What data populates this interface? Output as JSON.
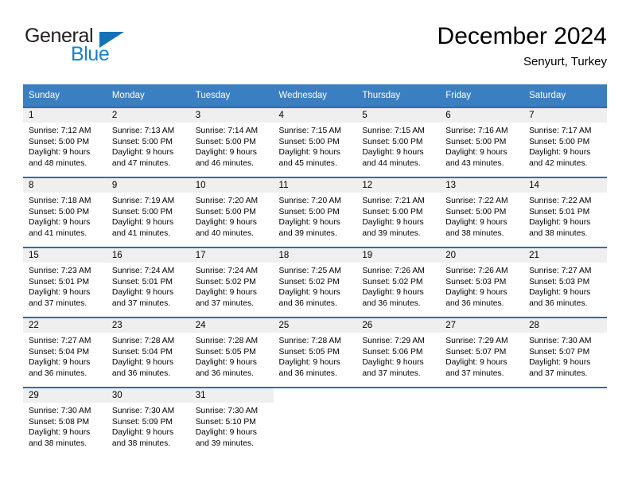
{
  "brand": {
    "name_part1": "General",
    "name_part2": "Blue",
    "logo_icon": "triangle-logo-icon"
  },
  "header": {
    "month_title": "December 2024",
    "location": "Senyurt, Turkey"
  },
  "colors": {
    "header_blue": "#3a7fc1",
    "row_divider_blue": "#2f6fad",
    "daynum_bg": "#efefef",
    "brand_blue": "#1f7fc4"
  },
  "weekday_headers": [
    "Sunday",
    "Monday",
    "Tuesday",
    "Wednesday",
    "Thursday",
    "Friday",
    "Saturday"
  ],
  "weeks": [
    [
      {
        "day": "1",
        "sunrise": "Sunrise: 7:12 AM",
        "sunset": "Sunset: 5:00 PM",
        "daylight1": "Daylight: 9 hours",
        "daylight2": "and 48 minutes."
      },
      {
        "day": "2",
        "sunrise": "Sunrise: 7:13 AM",
        "sunset": "Sunset: 5:00 PM",
        "daylight1": "Daylight: 9 hours",
        "daylight2": "and 47 minutes."
      },
      {
        "day": "3",
        "sunrise": "Sunrise: 7:14 AM",
        "sunset": "Sunset: 5:00 PM",
        "daylight1": "Daylight: 9 hours",
        "daylight2": "and 46 minutes."
      },
      {
        "day": "4",
        "sunrise": "Sunrise: 7:15 AM",
        "sunset": "Sunset: 5:00 PM",
        "daylight1": "Daylight: 9 hours",
        "daylight2": "and 45 minutes."
      },
      {
        "day": "5",
        "sunrise": "Sunrise: 7:15 AM",
        "sunset": "Sunset: 5:00 PM",
        "daylight1": "Daylight: 9 hours",
        "daylight2": "and 44 minutes."
      },
      {
        "day": "6",
        "sunrise": "Sunrise: 7:16 AM",
        "sunset": "Sunset: 5:00 PM",
        "daylight1": "Daylight: 9 hours",
        "daylight2": "and 43 minutes."
      },
      {
        "day": "7",
        "sunrise": "Sunrise: 7:17 AM",
        "sunset": "Sunset: 5:00 PM",
        "daylight1": "Daylight: 9 hours",
        "daylight2": "and 42 minutes."
      }
    ],
    [
      {
        "day": "8",
        "sunrise": "Sunrise: 7:18 AM",
        "sunset": "Sunset: 5:00 PM",
        "daylight1": "Daylight: 9 hours",
        "daylight2": "and 41 minutes."
      },
      {
        "day": "9",
        "sunrise": "Sunrise: 7:19 AM",
        "sunset": "Sunset: 5:00 PM",
        "daylight1": "Daylight: 9 hours",
        "daylight2": "and 41 minutes."
      },
      {
        "day": "10",
        "sunrise": "Sunrise: 7:20 AM",
        "sunset": "Sunset: 5:00 PM",
        "daylight1": "Daylight: 9 hours",
        "daylight2": "and 40 minutes."
      },
      {
        "day": "11",
        "sunrise": "Sunrise: 7:20 AM",
        "sunset": "Sunset: 5:00 PM",
        "daylight1": "Daylight: 9 hours",
        "daylight2": "and 39 minutes."
      },
      {
        "day": "12",
        "sunrise": "Sunrise: 7:21 AM",
        "sunset": "Sunset: 5:00 PM",
        "daylight1": "Daylight: 9 hours",
        "daylight2": "and 39 minutes."
      },
      {
        "day": "13",
        "sunrise": "Sunrise: 7:22 AM",
        "sunset": "Sunset: 5:00 PM",
        "daylight1": "Daylight: 9 hours",
        "daylight2": "and 38 minutes."
      },
      {
        "day": "14",
        "sunrise": "Sunrise: 7:22 AM",
        "sunset": "Sunset: 5:01 PM",
        "daylight1": "Daylight: 9 hours",
        "daylight2": "and 38 minutes."
      }
    ],
    [
      {
        "day": "15",
        "sunrise": "Sunrise: 7:23 AM",
        "sunset": "Sunset: 5:01 PM",
        "daylight1": "Daylight: 9 hours",
        "daylight2": "and 37 minutes."
      },
      {
        "day": "16",
        "sunrise": "Sunrise: 7:24 AM",
        "sunset": "Sunset: 5:01 PM",
        "daylight1": "Daylight: 9 hours",
        "daylight2": "and 37 minutes."
      },
      {
        "day": "17",
        "sunrise": "Sunrise: 7:24 AM",
        "sunset": "Sunset: 5:02 PM",
        "daylight1": "Daylight: 9 hours",
        "daylight2": "and 37 minutes."
      },
      {
        "day": "18",
        "sunrise": "Sunrise: 7:25 AM",
        "sunset": "Sunset: 5:02 PM",
        "daylight1": "Daylight: 9 hours",
        "daylight2": "and 36 minutes."
      },
      {
        "day": "19",
        "sunrise": "Sunrise: 7:26 AM",
        "sunset": "Sunset: 5:02 PM",
        "daylight1": "Daylight: 9 hours",
        "daylight2": "and 36 minutes."
      },
      {
        "day": "20",
        "sunrise": "Sunrise: 7:26 AM",
        "sunset": "Sunset: 5:03 PM",
        "daylight1": "Daylight: 9 hours",
        "daylight2": "and 36 minutes."
      },
      {
        "day": "21",
        "sunrise": "Sunrise: 7:27 AM",
        "sunset": "Sunset: 5:03 PM",
        "daylight1": "Daylight: 9 hours",
        "daylight2": "and 36 minutes."
      }
    ],
    [
      {
        "day": "22",
        "sunrise": "Sunrise: 7:27 AM",
        "sunset": "Sunset: 5:04 PM",
        "daylight1": "Daylight: 9 hours",
        "daylight2": "and 36 minutes."
      },
      {
        "day": "23",
        "sunrise": "Sunrise: 7:28 AM",
        "sunset": "Sunset: 5:04 PM",
        "daylight1": "Daylight: 9 hours",
        "daylight2": "and 36 minutes."
      },
      {
        "day": "24",
        "sunrise": "Sunrise: 7:28 AM",
        "sunset": "Sunset: 5:05 PM",
        "daylight1": "Daylight: 9 hours",
        "daylight2": "and 36 minutes."
      },
      {
        "day": "25",
        "sunrise": "Sunrise: 7:28 AM",
        "sunset": "Sunset: 5:05 PM",
        "daylight1": "Daylight: 9 hours",
        "daylight2": "and 36 minutes."
      },
      {
        "day": "26",
        "sunrise": "Sunrise: 7:29 AM",
        "sunset": "Sunset: 5:06 PM",
        "daylight1": "Daylight: 9 hours",
        "daylight2": "and 37 minutes."
      },
      {
        "day": "27",
        "sunrise": "Sunrise: 7:29 AM",
        "sunset": "Sunset: 5:07 PM",
        "daylight1": "Daylight: 9 hours",
        "daylight2": "and 37 minutes."
      },
      {
        "day": "28",
        "sunrise": "Sunrise: 7:30 AM",
        "sunset": "Sunset: 5:07 PM",
        "daylight1": "Daylight: 9 hours",
        "daylight2": "and 37 minutes."
      }
    ],
    [
      {
        "day": "29",
        "sunrise": "Sunrise: 7:30 AM",
        "sunset": "Sunset: 5:08 PM",
        "daylight1": "Daylight: 9 hours",
        "daylight2": "and 38 minutes."
      },
      {
        "day": "30",
        "sunrise": "Sunrise: 7:30 AM",
        "sunset": "Sunset: 5:09 PM",
        "daylight1": "Daylight: 9 hours",
        "daylight2": "and 38 minutes."
      },
      {
        "day": "31",
        "sunrise": "Sunrise: 7:30 AM",
        "sunset": "Sunset: 5:10 PM",
        "daylight1": "Daylight: 9 hours",
        "daylight2": "and 39 minutes."
      },
      {
        "day": "",
        "sunrise": "",
        "sunset": "",
        "daylight1": "",
        "daylight2": ""
      },
      {
        "day": "",
        "sunrise": "",
        "sunset": "",
        "daylight1": "",
        "daylight2": ""
      },
      {
        "day": "",
        "sunrise": "",
        "sunset": "",
        "daylight1": "",
        "daylight2": ""
      },
      {
        "day": "",
        "sunrise": "",
        "sunset": "",
        "daylight1": "",
        "daylight2": ""
      }
    ]
  ]
}
